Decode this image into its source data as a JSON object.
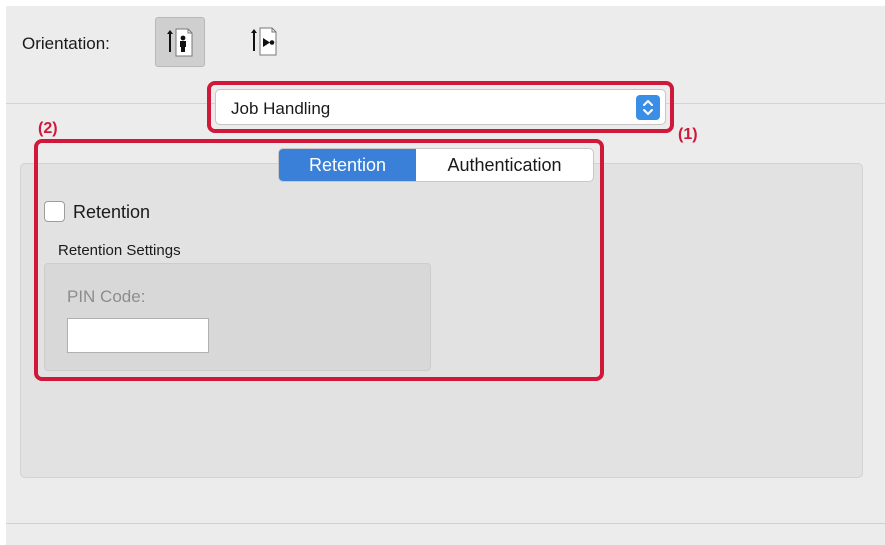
{
  "orientation": {
    "label": "Orientation:",
    "options": [
      {
        "name": "portrait",
        "icon": "portrait-orientation-icon",
        "selected": true
      },
      {
        "name": "landscape",
        "icon": "landscape-orientation-icon",
        "selected": false
      }
    ]
  },
  "panel_menu": {
    "selected": "Job Handling",
    "icon": "up-down-chevron-icon"
  },
  "callouts": {
    "one": "(1)",
    "two": "(2)"
  },
  "tabs": [
    {
      "label": "Retention",
      "active": true
    },
    {
      "label": "Authentication",
      "active": false
    }
  ],
  "retention": {
    "checkbox_label": "Retention",
    "checked": false,
    "settings_label": "Retention Settings",
    "pin_label": "PIN Code:",
    "pin_value": ""
  },
  "colors": {
    "accent": "#3a7fd8",
    "callout": "#d0183a",
    "background": "#ececec"
  }
}
